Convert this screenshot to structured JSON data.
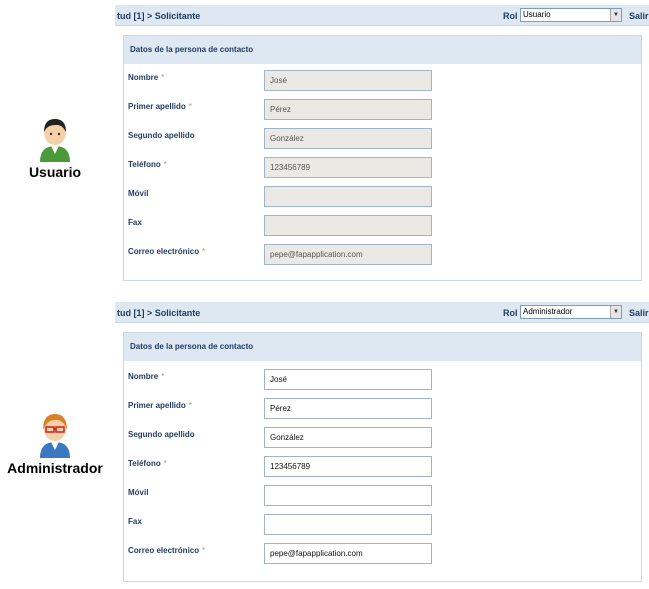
{
  "panels": [
    {
      "id": "usuario",
      "avatar_caption": "Usuario",
      "avatar_icon": "user-avatar-icon",
      "breadcrumb": "tud [1] > Solicitante",
      "rol_label": "Rol",
      "rol_selected": "Usuario",
      "salir_label": "Salir",
      "form_title": "Datos de la persona de contacto",
      "editable": false,
      "fields": [
        {
          "key": "nombre",
          "label": "Nombre",
          "required": true,
          "value": "José"
        },
        {
          "key": "primer-apellido",
          "label": "Primer apellido",
          "required": true,
          "value": "Pérez"
        },
        {
          "key": "segundo-apellido",
          "label": "Segundo apellido",
          "required": false,
          "value": "González"
        },
        {
          "key": "telefono",
          "label": "Teléfono",
          "required": true,
          "value": "123456789"
        },
        {
          "key": "movil",
          "label": "Móvil",
          "required": false,
          "value": ""
        },
        {
          "key": "fax",
          "label": "Fax",
          "required": false,
          "value": ""
        },
        {
          "key": "correo",
          "label": "Correo electrónico",
          "required": true,
          "value": "pepe@fapapplication.com"
        }
      ]
    },
    {
      "id": "administrador",
      "avatar_caption": "Administrador",
      "avatar_icon": "admin-avatar-icon",
      "breadcrumb": "tud [1] > Solicitante",
      "rol_label": "Rol",
      "rol_selected": "Administrador",
      "salir_label": "Salir",
      "form_title": "Datos de la persona de contacto",
      "editable": true,
      "fields": [
        {
          "key": "nombre",
          "label": "Nombre",
          "required": true,
          "value": "José"
        },
        {
          "key": "primer-apellido",
          "label": "Primer apellido",
          "required": true,
          "value": "Pérez"
        },
        {
          "key": "segundo-apellido",
          "label": "Segundo apellido",
          "required": false,
          "value": "González"
        },
        {
          "key": "telefono",
          "label": "Teléfono",
          "required": true,
          "value": "123456789"
        },
        {
          "key": "movil",
          "label": "Móvil",
          "required": false,
          "value": ""
        },
        {
          "key": "fax",
          "label": "Fax",
          "required": false,
          "value": ""
        },
        {
          "key": "correo",
          "label": "Correo electrónico",
          "required": true,
          "value": "pepe@fapapplication.com"
        }
      ]
    }
  ],
  "required_marker": "*",
  "colors": {
    "header_bg": "#dde8f2",
    "label_text": "#1f3a5f",
    "disabled_field_bg": "#eae9e4",
    "enabled_field_bg": "#ffffff"
  }
}
